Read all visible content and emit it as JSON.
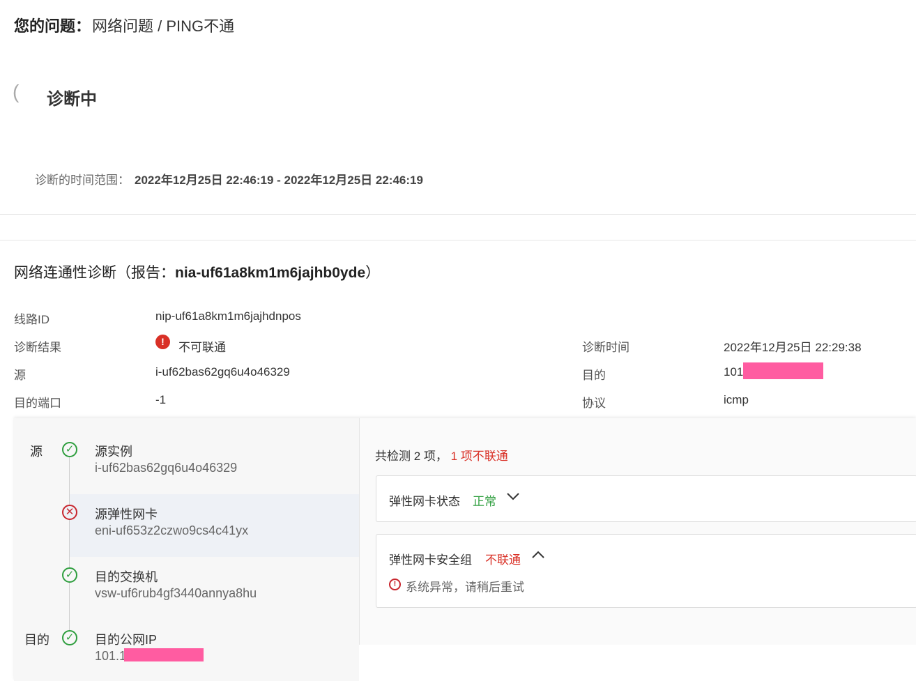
{
  "question": {
    "label": "您的问题：",
    "value": "网络问题 / PING不通"
  },
  "diagnosis": {
    "status": "诊断中",
    "spinner_glyph": "("
  },
  "time_range": {
    "label": "诊断的时间范围：",
    "value": "2022年12月25日 22:46:19 - 2022年12月25日 22:46:19"
  },
  "report": {
    "title_prefix": "网络连通性诊断（报告：",
    "report_id": "nia-uf61a8km1m6jajhb0yde",
    "title_suffix": "）"
  },
  "details": {
    "line_id_label": "线路ID",
    "line_id": "nip-uf61a8km1m6jajhdnpos",
    "result_label": "诊断结果",
    "result": "不可联通",
    "result_icon": "!",
    "time_label": "诊断时间",
    "time": "2022年12月25日 22:29:38",
    "source_label": "源",
    "source": "i-uf62bas62gq6u4o46329",
    "dest_label": "目的",
    "dest": "101",
    "port_label": "目的端口",
    "port": "-1",
    "protocol_label": "协议",
    "protocol": "icmp"
  },
  "path": {
    "source_side_label": "源",
    "dest_side_label": "目的",
    "steps": [
      {
        "title": "源实例",
        "id": "i-uf62bas62gq6u4o46329",
        "status": "ok"
      },
      {
        "title": "源弹性网卡",
        "id": "eni-uf653z2czwo9cs4c41yx",
        "status": "error"
      },
      {
        "title": "目的交换机",
        "id": "vsw-uf6rub4gf3440annya8hu",
        "status": "ok"
      },
      {
        "title": "目的公网IP",
        "id": "101.1",
        "status": "ok"
      }
    ],
    "ok_glyph": "✓",
    "error_glyph": "✕"
  },
  "checks": {
    "summary_prefix": "共检测 2 项，",
    "summary_bad": " 1 项不联通",
    "items": [
      {
        "title": "弹性网卡状态",
        "status": "正常",
        "expanded": false
      },
      {
        "title": "弹性网卡安全组",
        "status": "不联通",
        "expanded": true,
        "message": "系统异常，请稍后重试"
      }
    ],
    "chevron_down": "∨",
    "chevron_up": "∧",
    "warn_glyph": "!"
  },
  "colors": {
    "ok": "#2e9e3e",
    "error": "#d93026",
    "redaction": "#ff5ca1"
  }
}
